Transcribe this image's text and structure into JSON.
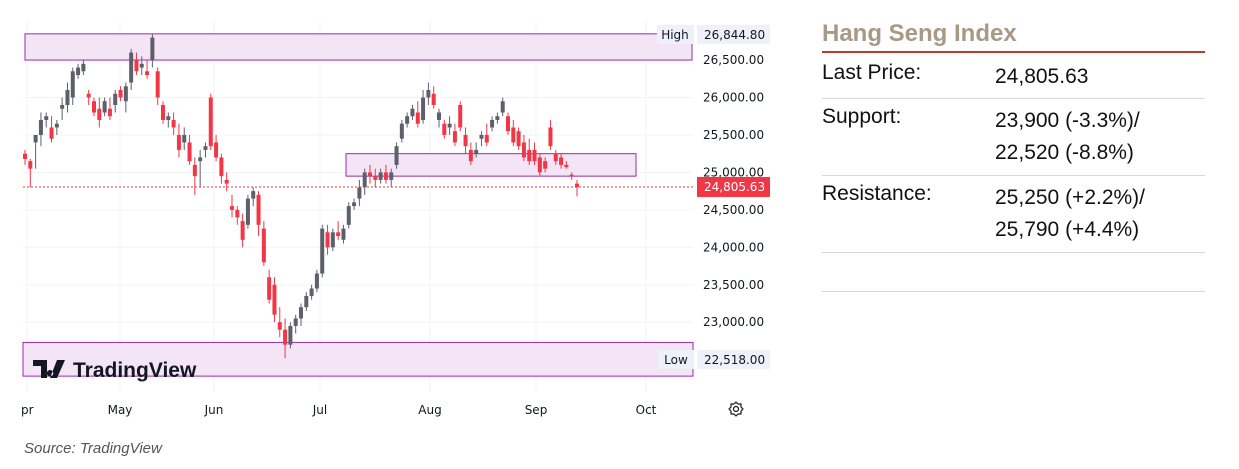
{
  "chart_data": {
    "type": "candlestick",
    "y_ticks": [
      "26,500.00",
      "26,000.00",
      "25,500.00",
      "25,000.00",
      "24,500.00",
      "24,000.00",
      "23,500.00",
      "23,000.00"
    ],
    "x_ticks": [
      "pr",
      "May",
      "Jun",
      "Jul",
      "Aug",
      "Sep",
      "Oct"
    ],
    "high_label": "High",
    "high_value": "26,844.80",
    "low_label": "Low",
    "low_value": "22,518.00",
    "last_value": "24,805.63",
    "ylim": [
      22500,
      26900
    ],
    "zones": [
      {
        "name": "high-zone",
        "from": 26500,
        "to": 26850
      },
      {
        "name": "resistance-zone",
        "from": 24950,
        "to": 25250
      },
      {
        "name": "low-zone",
        "from": 22280,
        "to": 22730
      }
    ],
    "colors": {
      "up": "#5d606b",
      "down": "#f23645",
      "zone_fill": "#f3e4f6",
      "zone_border": "#9c27b0",
      "last_price": "#f23645"
    },
    "candles": [
      [
        25250,
        25300,
        25100,
        25180
      ],
      [
        25150,
        25180,
        24800,
        25050
      ],
      [
        25400,
        25450,
        25050,
        25500
      ],
      [
        25500,
        25800,
        25350,
        25700
      ],
      [
        25700,
        25800,
        25600,
        25750
      ],
      [
        25600,
        25750,
        25400,
        25450
      ],
      [
        25600,
        25700,
        25500,
        25650
      ],
      [
        25850,
        26000,
        25700,
        25900
      ],
      [
        25900,
        26200,
        25800,
        26100
      ],
      [
        26000,
        26400,
        25900,
        26350
      ],
      [
        26300,
        26450,
        26250,
        26400
      ],
      [
        26350,
        26500,
        26300,
        26450
      ],
      [
        26050,
        26100,
        25900,
        26000
      ],
      [
        25950,
        26000,
        25750,
        25800
      ],
      [
        25850,
        26000,
        25600,
        25700
      ],
      [
        25800,
        26000,
        25750,
        25950
      ],
      [
        25850,
        26000,
        25700,
        25750
      ],
      [
        25900,
        26100,
        25800,
        26050
      ],
      [
        26100,
        26150,
        25950,
        26000
      ],
      [
        25950,
        26200,
        25800,
        26150
      ],
      [
        26200,
        26650,
        26100,
        26600
      ],
      [
        26500,
        26600,
        26300,
        26350
      ],
      [
        26400,
        26550,
        26300,
        26450
      ],
      [
        26350,
        26500,
        26250,
        26300
      ],
      [
        26500,
        26845,
        26400,
        26800
      ],
      [
        26350,
        26400,
        25900,
        26000
      ],
      [
        25900,
        25950,
        25650,
        25700
      ],
      [
        25700,
        25800,
        25600,
        25750
      ],
      [
        25700,
        25800,
        25500,
        25600
      ],
      [
        25500,
        25650,
        25200,
        25300
      ],
      [
        25400,
        25600,
        25300,
        25500
      ],
      [
        25400,
        25500,
        25100,
        25150
      ],
      [
        25100,
        25200,
        24700,
        24950
      ],
      [
        25150,
        25300,
        24800,
        25200
      ],
      [
        25300,
        25400,
        25200,
        25350
      ],
      [
        26000,
        26050,
        25300,
        25350
      ],
      [
        25400,
        25500,
        25150,
        25200
      ],
      [
        25200,
        25250,
        24850,
        24950
      ],
      [
        24900,
        25000,
        24750,
        24850
      ],
      [
        24550,
        24700,
        24400,
        24500
      ],
      [
        24500,
        24550,
        24300,
        24400
      ],
      [
        24350,
        24450,
        24000,
        24100
      ],
      [
        24300,
        24700,
        24250,
        24650
      ],
      [
        24650,
        24800,
        24550,
        24750
      ],
      [
        24700,
        24750,
        24150,
        24300
      ],
      [
        24250,
        24350,
        23750,
        23800
      ],
      [
        23600,
        23700,
        23250,
        23300
      ],
      [
        23500,
        23600,
        23000,
        23100
      ],
      [
        23000,
        23200,
        22800,
        22900
      ],
      [
        22900,
        23050,
        22518,
        22700
      ],
      [
        22700,
        23000,
        22650,
        22950
      ],
      [
        22950,
        23100,
        22850,
        23050
      ],
      [
        23050,
        23250,
        22950,
        23200
      ],
      [
        23200,
        23400,
        23150,
        23350
      ],
      [
        23350,
        23500,
        23300,
        23450
      ],
      [
        23450,
        23700,
        23400,
        23650
      ],
      [
        23650,
        24300,
        23600,
        24250
      ],
      [
        24200,
        24300,
        23900,
        24000
      ],
      [
        24000,
        24250,
        23950,
        24200
      ],
      [
        24200,
        24350,
        24100,
        24150
      ],
      [
        24100,
        24300,
        24050,
        24250
      ],
      [
        24300,
        24600,
        24250,
        24550
      ],
      [
        24550,
        24650,
        24500,
        24600
      ],
      [
        24650,
        24900,
        24550,
        24800
      ],
      [
        24800,
        25050,
        24700,
        25000
      ],
      [
        25000,
        25100,
        24850,
        24950
      ],
      [
        24950,
        25050,
        24800,
        24900
      ],
      [
        24900,
        25050,
        24850,
        25000
      ],
      [
        25000,
        25100,
        24850,
        24900
      ],
      [
        24900,
        25050,
        24800,
        25000
      ],
      [
        25100,
        25400,
        25050,
        25350
      ],
      [
        25450,
        25700,
        25400,
        25650
      ],
      [
        25650,
        25800,
        25600,
        25750
      ],
      [
        25750,
        25900,
        25700,
        25850
      ],
      [
        25800,
        25950,
        25600,
        25650
      ],
      [
        25700,
        26100,
        25650,
        26000
      ],
      [
        26000,
        26200,
        25900,
        26100
      ],
      [
        26050,
        26150,
        25850,
        25900
      ],
      [
        25700,
        25850,
        25600,
        25800
      ],
      [
        25650,
        25700,
        25450,
        25500
      ],
      [
        25600,
        25750,
        25500,
        25650
      ],
      [
        25550,
        25650,
        25350,
        25400
      ],
      [
        25900,
        25950,
        25550,
        25600
      ],
      [
        25500,
        25600,
        25250,
        25350
      ],
      [
        25300,
        25400,
        25100,
        25150
      ],
      [
        25250,
        25400,
        25200,
        25300
      ],
      [
        25450,
        25550,
        25350,
        25500
      ],
      [
        25500,
        25650,
        25350,
        25400
      ],
      [
        25600,
        25750,
        25550,
        25700
      ],
      [
        25700,
        25800,
        25650,
        25750
      ],
      [
        25800,
        26000,
        25750,
        25950
      ],
      [
        25750,
        25800,
        25500,
        25550
      ],
      [
        25600,
        25700,
        25350,
        25400
      ],
      [
        25550,
        25600,
        25300,
        25350
      ],
      [
        25400,
        25500,
        25150,
        25200
      ],
      [
        25300,
        25450,
        25100,
        25150
      ],
      [
        25300,
        25400,
        25100,
        25150
      ],
      [
        25200,
        25250,
        24950,
        25000
      ],
      [
        25150,
        25200,
        25000,
        25050
      ],
      [
        25600,
        25700,
        25300,
        25350
      ],
      [
        25250,
        25300,
        25100,
        25150
      ],
      [
        25200,
        25250,
        25050,
        25100
      ],
      [
        25100,
        25150,
        25050,
        25070
      ],
      [
        24970,
        25000,
        24900,
        24950
      ],
      [
        24850,
        24900,
        24680,
        24805.63
      ]
    ]
  },
  "watermark": "TradingView",
  "settings_icon": "gear-icon",
  "source": "Source: TradingView",
  "panel": {
    "title": "Hang Seng Index",
    "rows": [
      {
        "key": "Last Price:",
        "value_lines": [
          "24,805.63"
        ]
      },
      {
        "key": "Support:",
        "value_lines": [
          "23,900 (-3.3%)/",
          "22,520 (-8.8%)"
        ]
      },
      {
        "key": "Resistance:",
        "value_lines": [
          "25,250 (+2.2%)/",
          "25,790 (+4.4%)"
        ]
      }
    ]
  }
}
